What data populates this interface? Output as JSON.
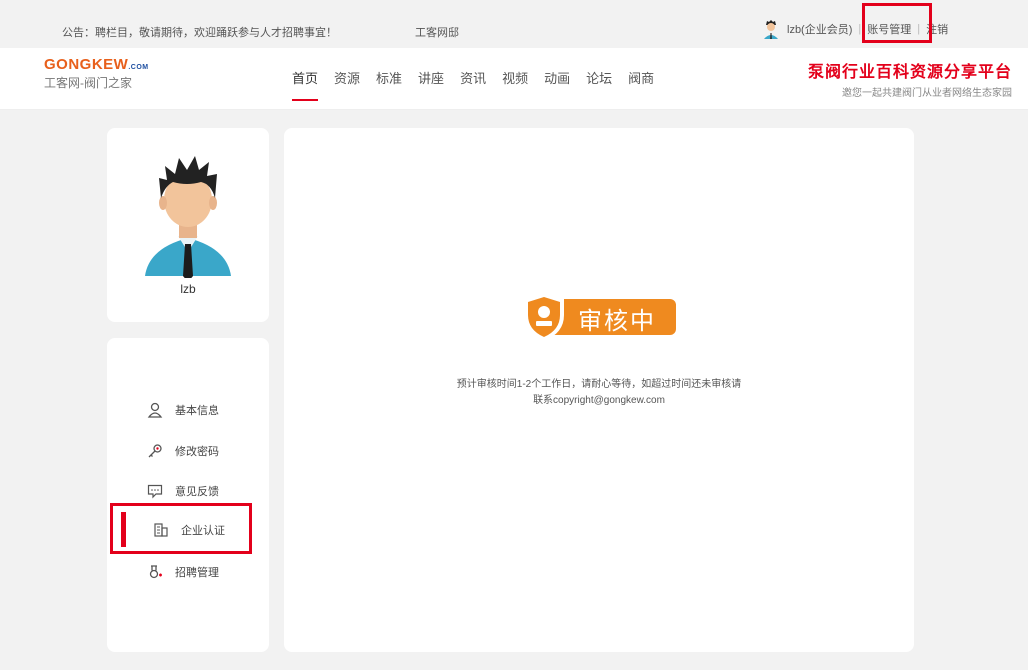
{
  "topbar": {
    "notice": "公告：聘栏目，敬请期待，欢迎踊跃参与人才招聘事宜！",
    "site_name": "工客网邸",
    "username": "lzb(企业会员)",
    "account_label": "账号管理",
    "separator": "|",
    "logout_label": "注销"
  },
  "header": {
    "logo_brand": "GONGKEW",
    "logo_com": ".COM",
    "logo_sub": "工客网-阀门之家",
    "nav": [
      "首页",
      "资源",
      "标准",
      "讲座",
      "资讯",
      "视频",
      "动画",
      "论坛",
      "阀商"
    ],
    "slogan_title": "泵阀行业百科资源分享平台",
    "slogan_sub": "邀您一起共建阀门从业者网络生态家园"
  },
  "profile": {
    "name": "lzb"
  },
  "menu": [
    {
      "label": "基本信息",
      "icon": "user-icon"
    },
    {
      "label": "修改密码",
      "icon": "key-icon"
    },
    {
      "label": "意见反馈",
      "icon": "feedback-icon"
    },
    {
      "label": "企业认证",
      "icon": "building-icon",
      "active": true
    },
    {
      "label": "招聘管理",
      "icon": "recruit-icon"
    }
  ],
  "status": {
    "label": "审核中",
    "note_line1": "预计审核时间1-2个工作日，请耐心等待，如超过时间还未审核请",
    "note_line2": "联系copyright@gongkew.com"
  },
  "colors": {
    "accent_red": "#e3001b",
    "status_orange": "#ef8a1f",
    "brand_orange": "#e8601c",
    "brand_blue": "#1e4fa1"
  }
}
